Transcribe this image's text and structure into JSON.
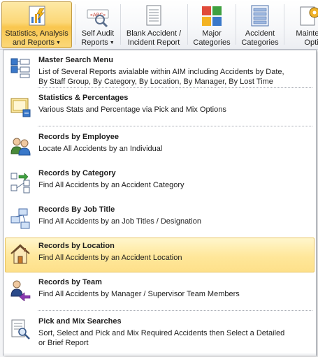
{
  "ribbon": {
    "buttons": [
      {
        "line1": "Statistics, Analysis",
        "line2": "and Reports",
        "dropdown": true,
        "icon": "statistics-report-icon"
      },
      {
        "line1": "Self Audit",
        "line2": "Reports",
        "dropdown": true,
        "icon": "spell-check-abc-icon"
      },
      {
        "line1": "Blank Accident /",
        "line2": "Incident Report",
        "dropdown": false,
        "icon": "blank-document-icon"
      },
      {
        "line1": "Major",
        "line2": "Categories",
        "dropdown": false,
        "icon": "color-grid-icon"
      },
      {
        "line1": "Accident",
        "line2": "Categories",
        "dropdown": false,
        "icon": "list-document-icon"
      },
      {
        "line1": "Mainten",
        "line2": "Optio",
        "dropdown": false,
        "icon": "gear-icon"
      }
    ]
  },
  "menu": {
    "items": [
      {
        "title": "Master Search Menu",
        "desc1": "List of Several Reports avialable within AIM including Accidents by Date,",
        "desc2": "By Staff Group, By Category, By Location, By Manager, By Lost Time",
        "icon": "master-search-icon"
      },
      {
        "title": "Statistics & Percentages",
        "desc1": "Various Stats and Percentage via Pick and Mix Options",
        "desc2": "",
        "icon": "statistics-chart-icon"
      },
      {
        "title": "Records by Employee",
        "desc1": "Locate All Accidents by an Individual",
        "desc2": "",
        "icon": "employees-icon"
      },
      {
        "title": "Records by Category",
        "desc1": "Find All Accidents by an Accident Category",
        "desc2": "",
        "icon": "category-tree-icon"
      },
      {
        "title": "Records By Job Title",
        "desc1": "Find All Accidents by an Job Titles / Designation",
        "desc2": "",
        "icon": "org-chart-icon"
      },
      {
        "title": "Records by Location",
        "desc1": "Find All Accidents by an Accident Location",
        "desc2": "",
        "icon": "house-icon"
      },
      {
        "title": "Records by Team",
        "desc1": "Find All Accidents by Manager / Supervisor Team Members",
        "desc2": "",
        "icon": "team-arrow-icon"
      },
      {
        "title": "Pick and Mix Searches",
        "desc1": "Sort, Select and Pick and Mix Required Accidents then Select a Detailed",
        "desc2": "or Brief Report",
        "icon": "search-document-icon"
      }
    ],
    "highlighted_index": 5
  },
  "colors": {
    "active_button": "#f9c64e",
    "highlight": "#ffe79a",
    "accent_blue": "#2a6bc7"
  }
}
